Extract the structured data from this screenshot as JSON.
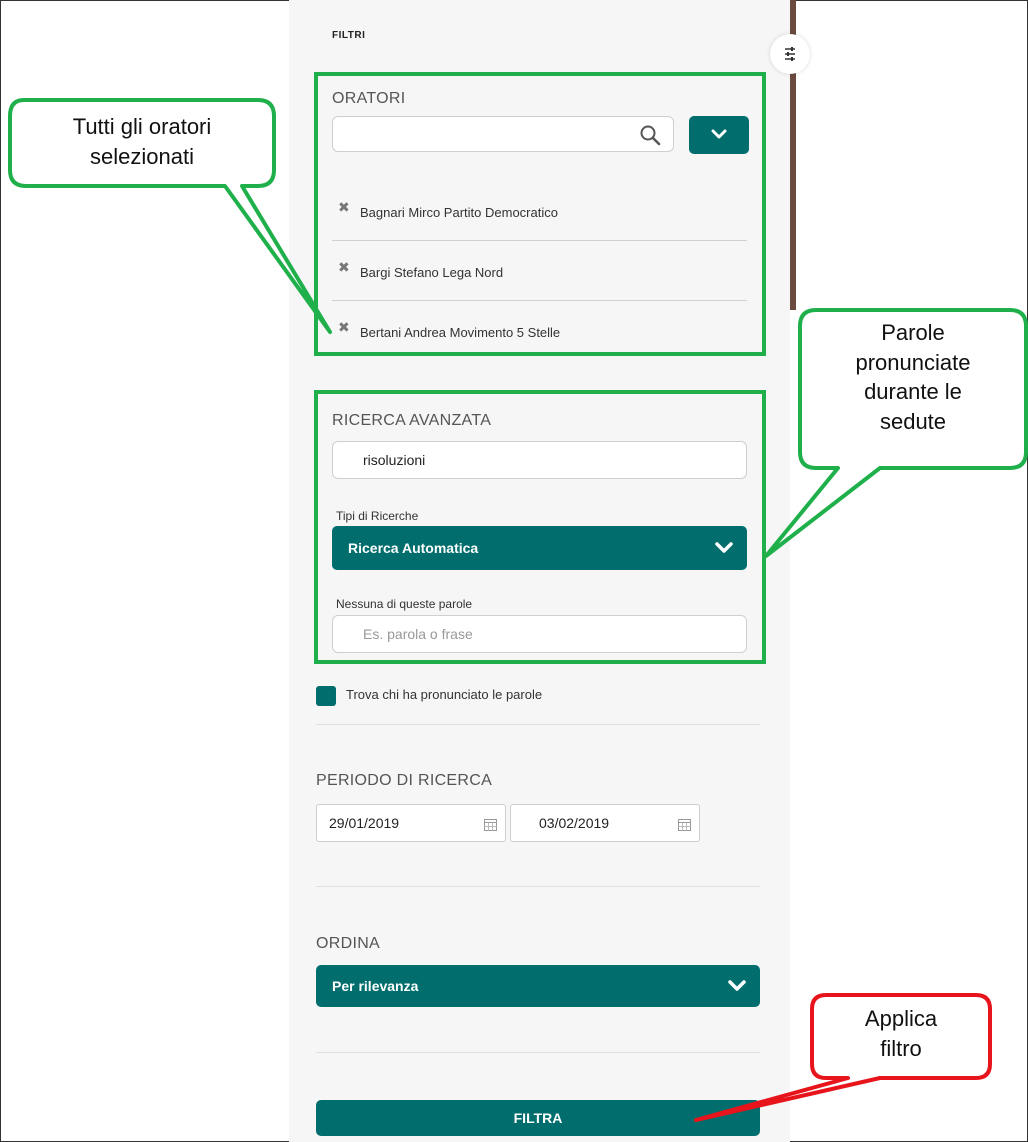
{
  "panel": {
    "title": "FILTRI"
  },
  "oratori": {
    "label": "ORATORI",
    "search_value": "",
    "selected": [
      "Bagnari Mirco Partito Democratico",
      "Bargi Stefano Lega Nord",
      "Bertani Andrea Movimento 5 Stelle"
    ],
    "remove_glyph": "✖"
  },
  "ricerca": {
    "label": "RICERCA AVANZATA",
    "query_value": "risoluzioni",
    "tipi_label": "Tipi di Ricerche",
    "tipi_selected": "Ricerca Automatica",
    "nessuna_label": "Nessuna di queste parole",
    "nessuna_placeholder": "Es. parola o frase"
  },
  "checkbox": {
    "label": "Trova chi ha pronunciato le parole"
  },
  "periodo": {
    "label": "PERIODO DI RICERCA",
    "from": "29/01/2019",
    "to": "03/02/2019"
  },
  "ordina": {
    "label": "ORDINA",
    "selected": "Per rilevanza"
  },
  "filtra": {
    "label": "FILTRA"
  },
  "annotations": {
    "oratori_callout": [
      "Tutti gli oratori",
      "selezionati"
    ],
    "parole_callout": [
      "Parole",
      "pronunciate",
      "durante le",
      "sedute"
    ],
    "applica_callout": [
      "Applica",
      "filtro"
    ]
  },
  "colors": {
    "teal": "#016e6d",
    "annotation_green": "#1fb04b",
    "annotation_red": "#e8141c"
  }
}
